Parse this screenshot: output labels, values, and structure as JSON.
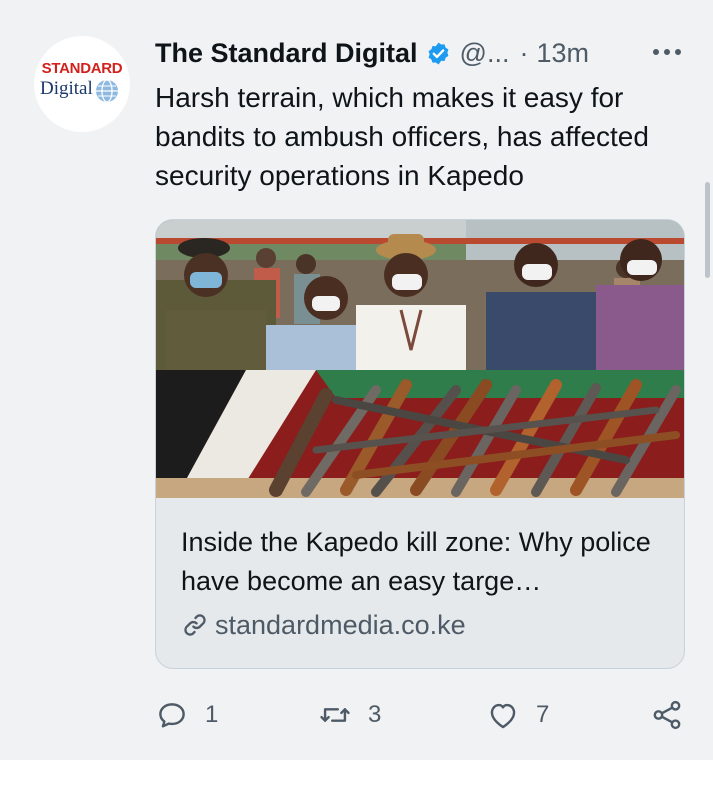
{
  "author": {
    "avatar_text_top": "STANDARD",
    "avatar_text_bottom": "Digital",
    "name": "The Standard Digital",
    "verified": true,
    "handle": "@...",
    "separator": "·",
    "time": "13m"
  },
  "tweet": {
    "text": "Harsh terrain, which makes it easy for bandits to ambush officers, has affected security operations in Kapedo"
  },
  "card": {
    "title": "Inside the Kapedo kill zone: Why police have become an easy targe…",
    "domain": "standardmedia.co.ke",
    "image_icon": "news-photo-officials-with-recovered-guns"
  },
  "actions": {
    "reply_count": "1",
    "retweet_count": "3",
    "like_count": "7"
  },
  "colors": {
    "background": "#f0f2f4",
    "text_primary": "#0f1419",
    "text_secondary": "#4e5b66",
    "verified_blue": "#1d9bf0",
    "card_border": "#c9d2d9",
    "brand_red": "#d3211e"
  }
}
